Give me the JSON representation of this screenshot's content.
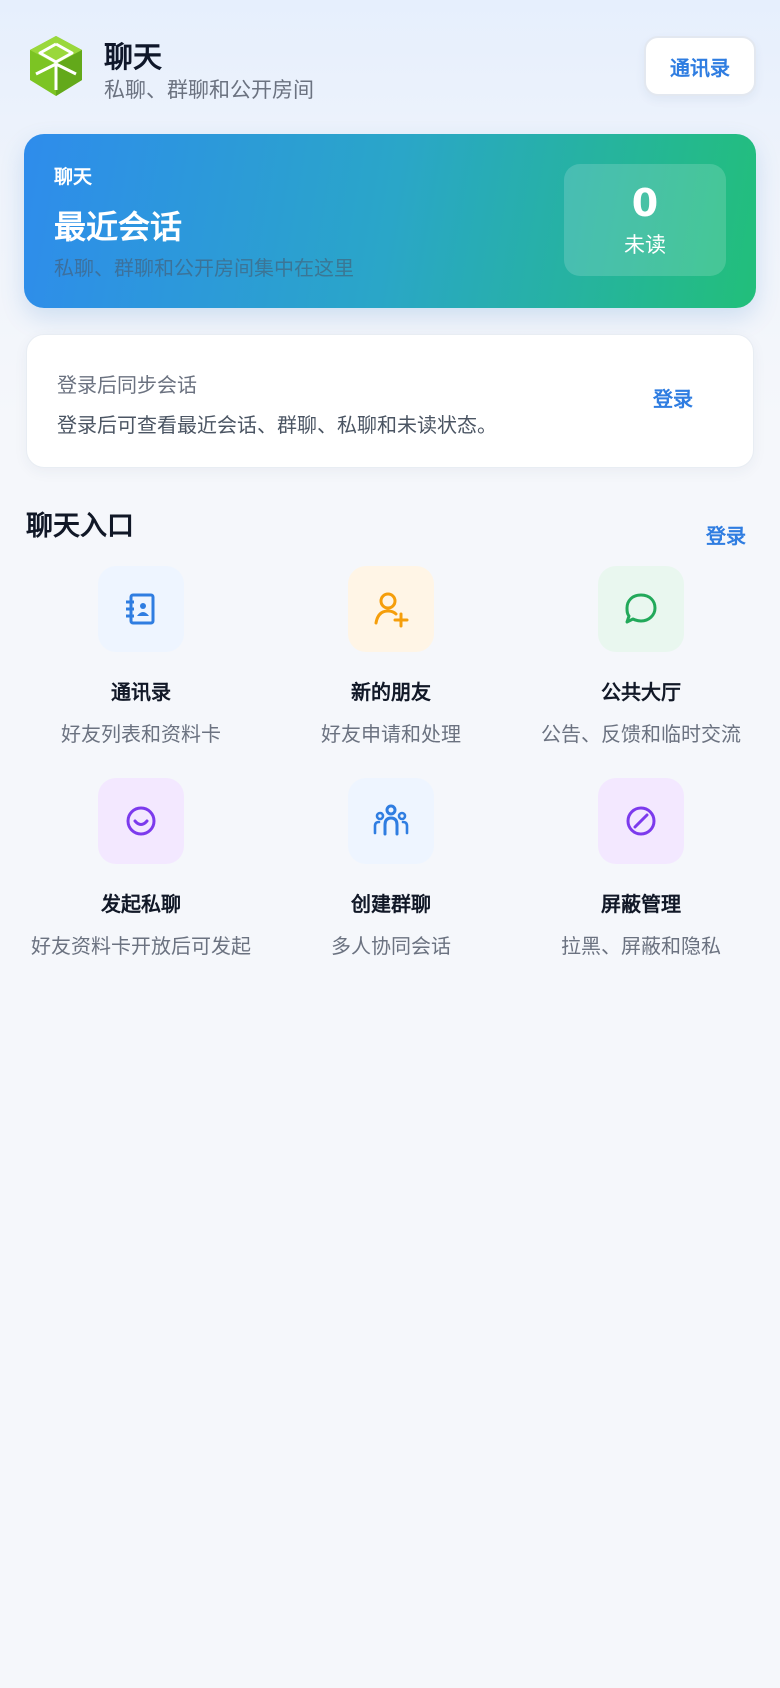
{
  "header": {
    "title": "聊天",
    "subtitle": "私聊、群聊和公开房间",
    "contacts_button": "通讯录",
    "logo_icon": "cube-logo-icon"
  },
  "hero": {
    "label": "聊天",
    "title": "最近会话",
    "description": "私聊、群聊和公开房间集中在这里",
    "unread_count": "0",
    "unread_label": "未读"
  },
  "login_card": {
    "title": "登录后同步会话",
    "description": "登录后可查看最近会话、群聊、私聊和未读状态。",
    "button": "登录"
  },
  "section": {
    "title": "聊天入口",
    "login_link": "登录"
  },
  "tiles": [
    {
      "name": "通讯录",
      "desc": "好友列表和资料卡",
      "icon": "address-book-icon",
      "color": "#2f7de1",
      "bg": "#eef5ff"
    },
    {
      "name": "新的朋友",
      "desc": "好友申请和处理",
      "icon": "add-user-icon",
      "color": "#f59e0b",
      "bg": "#fff5e6"
    },
    {
      "name": "公共大厅",
      "desc": "公告、反馈和临时交流",
      "icon": "chat-bubble-icon",
      "color": "#22a95a",
      "bg": "#e9f7ef"
    },
    {
      "name": "发起私聊",
      "desc": "好友资料卡开放后可发起",
      "icon": "smile-icon",
      "color": "#7c3aed",
      "bg": "#f3e8ff"
    },
    {
      "name": "创建群聊",
      "desc": "多人协同会话",
      "icon": "group-icon",
      "color": "#2f7de1",
      "bg": "#eef5ff"
    },
    {
      "name": "屏蔽管理",
      "desc": "拉黑、屏蔽和隐私",
      "icon": "block-icon",
      "color": "#7c3aed",
      "bg": "#f3e8ff"
    }
  ]
}
